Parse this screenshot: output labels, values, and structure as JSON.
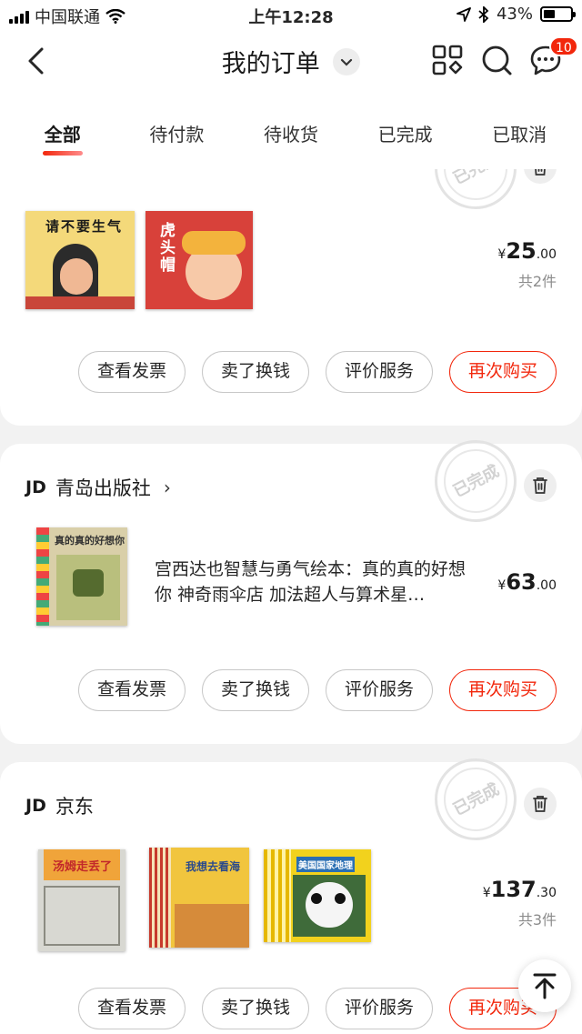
{
  "status_bar": {
    "carrier": "中国联通",
    "time": "上午12:28",
    "battery": "43%",
    "battery_level": 0.43
  },
  "nav": {
    "title": "我的订单",
    "message_badge": "10"
  },
  "tabs": [
    "全部",
    "待付款",
    "待收货",
    "已完成",
    "已取消"
  ],
  "orders": [
    {
      "stamp": "已完成",
      "price_symbol": "¥",
      "price_int": "25",
      "price_dec": ".00",
      "count": "共2件",
      "books": [
        {
          "title": "请不要生气"
        },
        {
          "title": "虎头帽"
        }
      ]
    },
    {
      "shop": "青岛出版社",
      "stamp": "已完成",
      "book_title": "真的真的好想你",
      "description": "宫西达也智慧与勇气绘本：真的真的好想你 神奇雨伞店 加法超人与算术星…",
      "price_symbol": "¥",
      "price_int": "63",
      "price_dec": ".00"
    },
    {
      "shop": "京东",
      "stamp": "已完成",
      "price_symbol": "¥",
      "price_int": "137",
      "price_dec": ".30",
      "count": "共3件",
      "books": [
        {
          "title": "汤姆走丢了"
        },
        {
          "title": "我想去看海"
        },
        {
          "title": "美国国家地理"
        }
      ]
    }
  ],
  "buttons": {
    "invoice": "查看发票",
    "sell": "卖了换钱",
    "review": "评价服务",
    "rebuy": "再次购买"
  },
  "brand": "JD",
  "colors": {
    "accent": "#f2270c"
  }
}
